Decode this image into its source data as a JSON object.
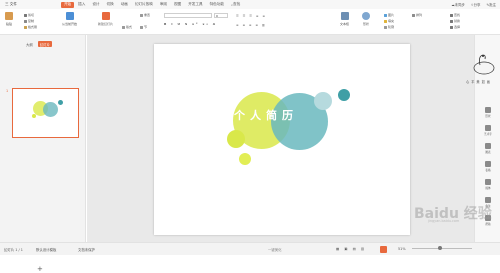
{
  "menu": {
    "file_label": "三 文件",
    "items": [
      "开始",
      "插入",
      "设计",
      "切换",
      "动画",
      "幻灯片放映",
      "审阅",
      "视图",
      "开发工具",
      "特色功能"
    ],
    "active_index": 0,
    "search_label": "查找",
    "unsynced_label": "未同步",
    "share_label": "分享",
    "comment_label": "批注"
  },
  "ribbon": {
    "paste": "粘贴",
    "cut": "剪切",
    "copy": "复制",
    "format_painter": "格式刷",
    "from_current": "从当前开始",
    "new_slide": "新建幻灯片",
    "layout": "版式",
    "reset": "重置",
    "section": "节",
    "font_size_value": "0",
    "textbox": "文本框",
    "shape": "形状",
    "arrange": "排列",
    "picture": "图片",
    "fill": "填充",
    "outline": "轮廓",
    "find": "查找",
    "replace": "替换",
    "select": "选择"
  },
  "left_panel": {
    "tab_outline": "大纲",
    "tab_slides": "幻灯片",
    "slide_number": "1",
    "add_symbol": "+"
  },
  "slide": {
    "title": "个人简历"
  },
  "colors": {
    "accent": "#e8693d",
    "lime": "#d9e84a",
    "teal": "#6ab8be",
    "teal_dark": "#3f9fa6"
  },
  "right_bar": {
    "items": [
      "形状",
      "艺术字",
      "图表",
      "表格",
      "媒体",
      "备注",
      "帮助"
    ]
  },
  "statusbar": {
    "slide_info": "幻灯片 1 / 1",
    "theme": "默认设计模板",
    "doc_protect": "文档未保护",
    "notes": "单击此处添加备注",
    "zoom_label": "一键美化",
    "zoom_pct": "51%"
  },
  "watermark": {
    "brand": "Baidu 经验",
    "site": "jingyan.baidu.com",
    "corner_text": "心 平 美 如 画"
  }
}
